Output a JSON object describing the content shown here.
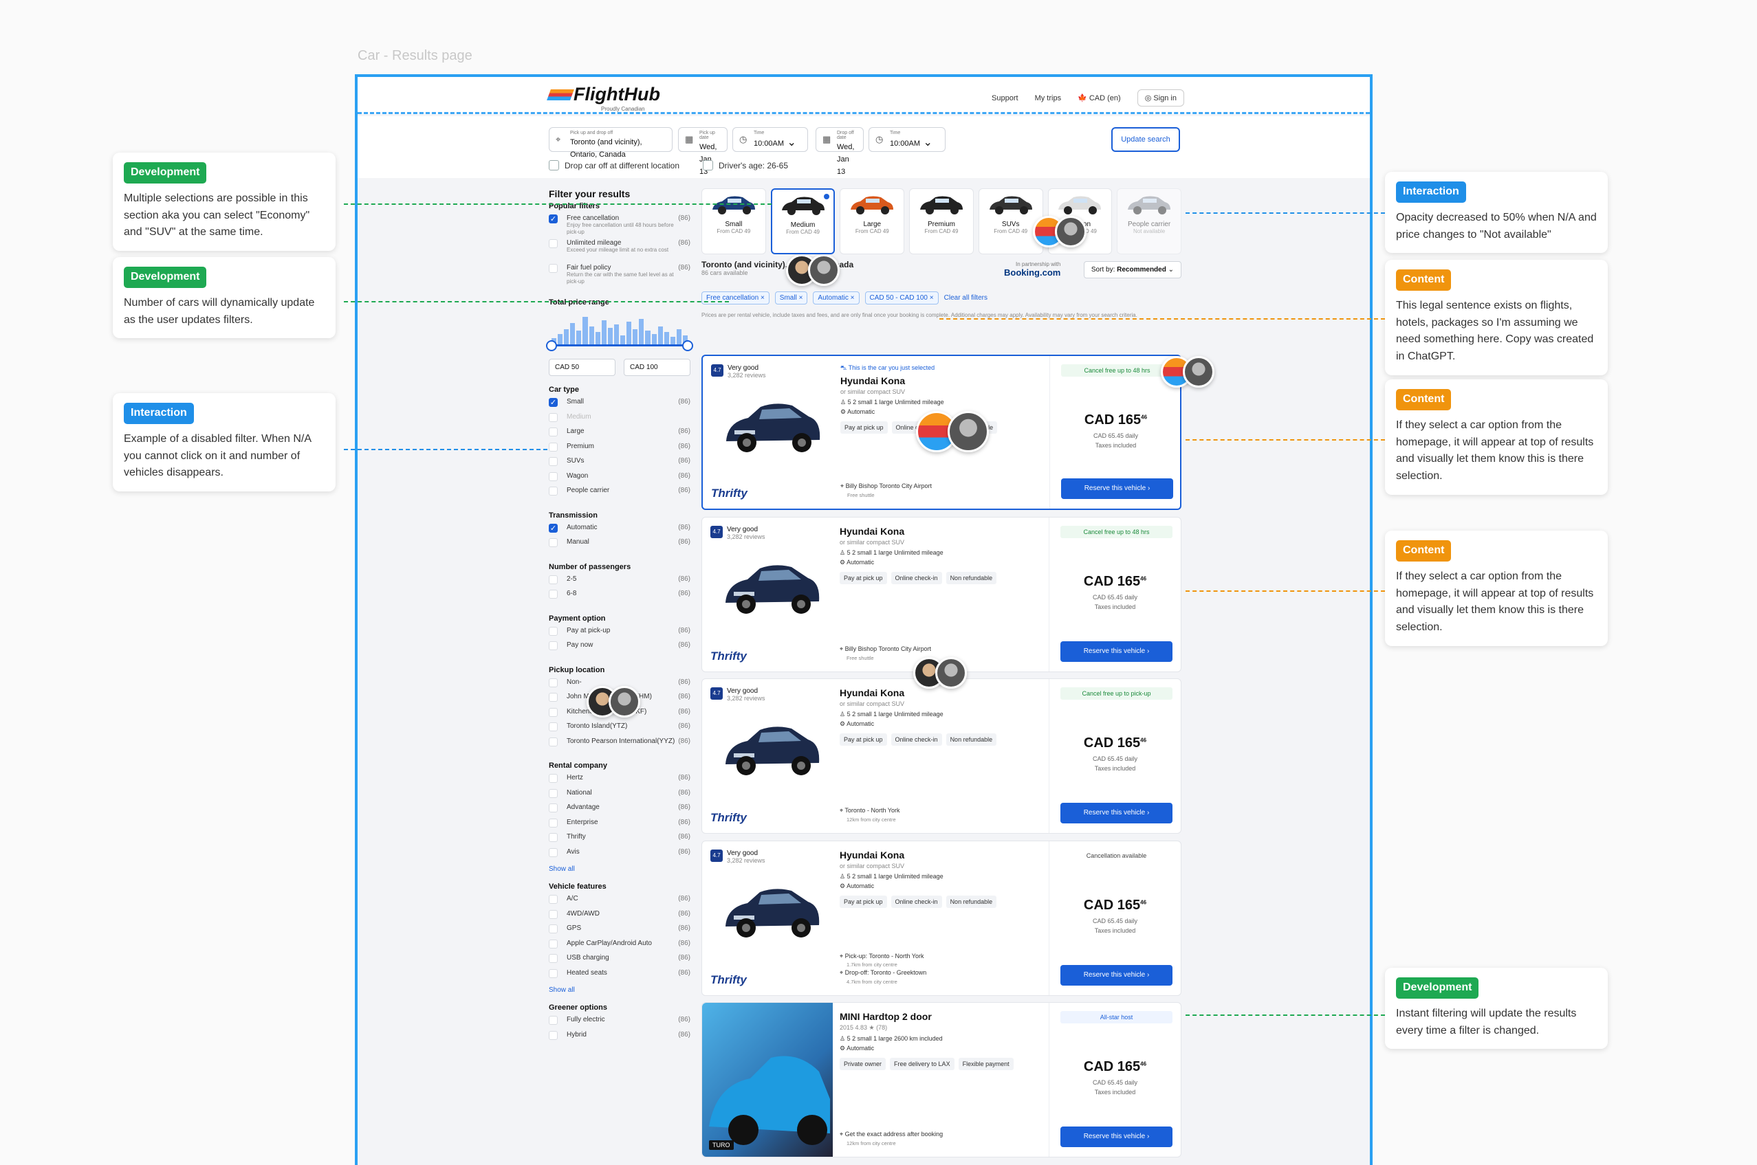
{
  "frame_title": "Car - Results page",
  "header": {
    "brand": "FlightHub",
    "tagline": "Proudly Canadian",
    "nav": [
      "Support",
      "My trips"
    ],
    "currency": "CAD (en)",
    "signin": "Sign in"
  },
  "search": {
    "pickup_label": "Pick up and drop off",
    "pickup_value": "Toronto (and vicinity), Ontario, Canada",
    "pickup_date_label": "Pick up date",
    "pickup_date": "Wed, Jan 13",
    "time_label": "Time",
    "pickup_time": "10:00AM",
    "dropoff_date_label": "Drop off date",
    "dropoff_date": "Wed, Jan 13",
    "dropoff_time": "10:00AM",
    "update": "Update search",
    "drop_diff": "Drop car off at different location",
    "driver_age": "Driver's age: 26-65"
  },
  "filters": {
    "title": "Filter your results",
    "popular_title": "Popular filters",
    "popular": [
      {
        "label": "Free cancellation",
        "sub": "Enjoy free cancellation until 48 hours before pick-up",
        "count": "(86)",
        "checked": true
      },
      {
        "label": "Unlimited mileage",
        "sub": "Exceed your mileage limit at no extra cost",
        "count": "(86)",
        "checked": false
      },
      {
        "label": "Fair fuel policy",
        "sub": "Return the car with the same fuel level as at pick-up",
        "count": "(86)",
        "checked": false
      }
    ],
    "price_title": "Total price range",
    "price_min": "CAD 50",
    "price_max": "CAD 100",
    "cartype_title": "Car type",
    "cartype": [
      {
        "label": "Small",
        "count": "(86)",
        "checked": true
      },
      {
        "label": "Medium",
        "count": "",
        "checked": false,
        "disabled": true
      },
      {
        "label": "Large",
        "count": "(86)",
        "checked": false
      },
      {
        "label": "Premium",
        "count": "(86)",
        "checked": false
      },
      {
        "label": "SUVs",
        "count": "(86)",
        "checked": false
      },
      {
        "label": "Wagon",
        "count": "(86)",
        "checked": false
      },
      {
        "label": "People carrier",
        "count": "(86)",
        "checked": false
      }
    ],
    "trans_title": "Transmission",
    "trans": [
      {
        "label": "Automatic",
        "count": "(86)",
        "checked": true
      },
      {
        "label": "Manual",
        "count": "(86)",
        "checked": false
      }
    ],
    "pass_title": "Number of passengers",
    "pass": [
      {
        "label": "2-5",
        "count": "(86)"
      },
      {
        "label": "6-8",
        "count": "(86)"
      }
    ],
    "pay_title": "Payment option",
    "pay": [
      {
        "label": "Pay at pick-up",
        "count": "(86)"
      },
      {
        "label": "Pay now",
        "count": "(86)"
      }
    ],
    "pickup_title": "Pickup location",
    "pickup": [
      {
        "label": "Non-",
        "count": "(86)"
      },
      {
        "label": "John Munro Hamilton(YHM)",
        "count": "(86)"
      },
      {
        "label": "Kitchener / Waterloo(YKF)",
        "count": "(86)"
      },
      {
        "label": "Toronto Island(YTZ)",
        "count": "(86)"
      },
      {
        "label": "Toronto Pearson International(YYZ)",
        "count": "(86)"
      }
    ],
    "rental_title": "Rental company",
    "rental": [
      {
        "label": "Hertz",
        "count": "(86)"
      },
      {
        "label": "National",
        "count": "(86)"
      },
      {
        "label": "Advantage",
        "count": "(86)"
      },
      {
        "label": "Enterprise",
        "count": "(86)"
      },
      {
        "label": "Thrifty",
        "count": "(86)"
      },
      {
        "label": "Avis",
        "count": "(86)"
      }
    ],
    "show_all": "Show all",
    "features_title": "Vehicle features",
    "features": [
      {
        "label": "A/C",
        "count": "(86)"
      },
      {
        "label": "4WD/AWD",
        "count": "(86)"
      },
      {
        "label": "GPS",
        "count": "(86)"
      },
      {
        "label": "Apple CarPlay/Android Auto",
        "count": "(86)"
      },
      {
        "label": "USB charging",
        "count": "(86)"
      },
      {
        "label": "Heated seats",
        "count": "(86)"
      }
    ],
    "green_title": "Greener options",
    "green": [
      {
        "label": "Fully electric",
        "count": "(86)"
      },
      {
        "label": "Hybrid",
        "count": "(86)"
      }
    ]
  },
  "categories": [
    {
      "name": "Small",
      "price": "From CAD 49",
      "color": "#1d3f7a"
    },
    {
      "name": "Medium",
      "price": "From CAD 49",
      "color": "#222"
    },
    {
      "name": "Large",
      "price": "From CAD 49",
      "color": "#d9591c"
    },
    {
      "name": "Premium",
      "price": "From CAD 49",
      "color": "#222"
    },
    {
      "name": "SUVs",
      "price": "From CAD 49",
      "color": "#333"
    },
    {
      "name": "Wagon",
      "price": "From CAD 49",
      "color": "#ddd"
    },
    {
      "name": "People carrier",
      "price": "Not available",
      "color": "#8a8f99"
    }
  ],
  "results": {
    "location": "Toronto (and vicinity), Ontario, Canada",
    "count": "86 cars available",
    "partner_label": "In partnership with",
    "partner": "Booking.com",
    "sort_label": "Sort by:",
    "sort_value": "Recommended",
    "clear": "Clear all filters",
    "chips": [
      "Free cancellation",
      "Small",
      "Automatic",
      "CAD 50 - CAD 100"
    ],
    "legal": "Prices are per rental vehicle, include taxes and fees, and are only final once your booking is complete. Additional charges may apply. Availability may vary from your search criteria."
  },
  "cards": [
    {
      "score": "4.7",
      "rating": "Very good",
      "reviews": "3,282 reviews",
      "just": "This is the car you just selected",
      "name": "Hyundai Kona",
      "similar": "or similar compact SUV",
      "feats": "5  2 small  1 large  Unlimited mileage",
      "trans": "Automatic",
      "tags": [
        "Pay at pick up",
        "Online check-in",
        "Non refundable"
      ],
      "pick": "Billy Bishop Toronto City Airport",
      "pick_sub": "Free shuttle",
      "cancel": "Cancel free up to 48 hrs",
      "price": "CAD 165",
      "cents": "46",
      "daily": "CAD 65.45 daily",
      "taxes": "Taxes included",
      "reserve": "Reserve this vehicle",
      "vendor": "Thrifty"
    },
    {
      "score": "4.7",
      "rating": "Very good",
      "reviews": "3,282 reviews",
      "name": "Hyundai Kona",
      "similar": "or similar compact SUV",
      "feats": "5  2 small  1 large  Unlimited mileage",
      "trans": "Automatic",
      "tags": [
        "Pay at pick up",
        "Online check-in",
        "Non refundable"
      ],
      "pick": "Billy Bishop Toronto City Airport",
      "pick_sub": "Free shuttle",
      "cancel": "Cancel free up to 48 hrs",
      "price": "CAD 165",
      "cents": "46",
      "daily": "CAD 65.45 daily",
      "taxes": "Taxes included",
      "reserve": "Reserve this vehicle",
      "vendor": "Thrifty"
    },
    {
      "score": "4.7",
      "rating": "Very good",
      "reviews": "3,282 reviews",
      "name": "Hyundai Kona",
      "similar": "or similar compact SUV",
      "feats": "5  2 small  1 large  Unlimited mileage",
      "trans": "Automatic",
      "tags": [
        "Pay at pick up",
        "Online check-in",
        "Non refundable"
      ],
      "pick": "Toronto - North York",
      "pick_sub": "12km from city centre",
      "cancel": "Cancel free up to pick-up",
      "price": "CAD 165",
      "cents": "46",
      "daily": "CAD 65.45 daily",
      "taxes": "Taxes included",
      "reserve": "Reserve this vehicle",
      "vendor": "Thrifty"
    },
    {
      "score": "4.7",
      "rating": "Very good",
      "reviews": "3,282 reviews",
      "name": "Hyundai Kona",
      "similar": "or similar compact SUV",
      "feats": "5  2 small  1 large  Unlimited mileage",
      "trans": "Automatic",
      "tags": [
        "Pay at pick up",
        "Online check-in",
        "Non refundable"
      ],
      "pick": "Pick-up: Toronto - North York",
      "pick_sub": "1.7km from city centre",
      "pick2": "Drop-off: Toronto - Greektown",
      "pick2_sub": "4.7km from city centre",
      "cancel": "Cancellation available",
      "price": "CAD 165",
      "cents": "46",
      "daily": "CAD 65.45 daily",
      "taxes": "Taxes included",
      "reserve": "Reserve this vehicle",
      "vendor": "Thrifty"
    },
    {
      "name": "MINI Hardtop 2 door",
      "similar": "2015  4.83 ★ (78)",
      "feats": "5  2 small  1 large  2600 km included",
      "trans": "Automatic",
      "tags": [
        "Private owner",
        "Free delivery to LAX",
        "Flexible payment"
      ],
      "pick": "Get the exact address after booking",
      "pick_sub": "12km from city centre",
      "cancel": "All-star host",
      "price": "CAD 165",
      "cents": "46",
      "daily": "CAD 65.45 daily",
      "taxes": "Taxes included",
      "reserve": "Reserve this vehicle",
      "vendor": "TURO"
    }
  ],
  "notes": [
    {
      "badge": "Development",
      "text": "Multiple selections are possible in this section aka you can select \"Economy\" and \"SUV\" at the same time."
    },
    {
      "badge": "Development",
      "text": "Number of cars will dynamically update as the user updates filters."
    },
    {
      "badge": "Interaction",
      "text": "Example of a disabled filter. When N/A you cannot click on it and number of vehicles disappears."
    },
    {
      "badge": "Interaction",
      "text": "Opacity decreased to 50% when N/A and price changes to \"Not available\""
    },
    {
      "badge": "Content",
      "text": "This legal sentence exists on flights, hotels, packages so I'm assuming we need something here. Copy was created in ChatGPT."
    },
    {
      "badge": "Content",
      "text": "If they select a car option from the homepage, it will appear at top of results and visually let them know this is there selection."
    },
    {
      "badge": "Content",
      "text": "If they select a car option from the homepage, it will appear at top of results and visually let them know this is there selection."
    },
    {
      "badge": "Development",
      "text": "Instant filtering will update the results every time a filter is changed."
    }
  ]
}
